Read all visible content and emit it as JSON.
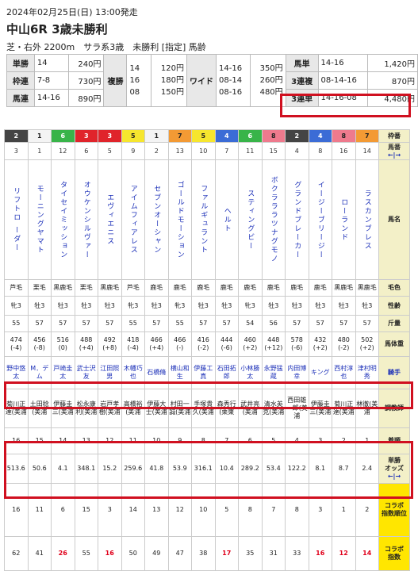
{
  "header": {
    "date": "2024年02月25日(日) 13:00発走",
    "title": "中山6R 3歳未勝利",
    "conditions": "芝・右外 2200m　サラ系3歳　未勝利 [指定] 馬齢"
  },
  "payout": {
    "tansho": {
      "label": "単勝",
      "combo": "14",
      "amount": "240円"
    },
    "wakuren": {
      "label": "枠連",
      "combo": "7-8",
      "amount": "730円"
    },
    "umaren": {
      "label": "馬連",
      "combo": "14-16",
      "amount": "890円"
    },
    "fukusho": {
      "label": "複勝",
      "combos": [
        "14",
        "16",
        "08"
      ],
      "amounts": [
        "120円",
        "180円",
        "150円"
      ]
    },
    "wide": {
      "label": "ワイド",
      "combos": [
        "14-16",
        "08-14",
        "08-16"
      ],
      "amounts": [
        "350円",
        "260円",
        "480円"
      ]
    },
    "umatan": {
      "label": "馬単",
      "combo": "14-16",
      "amount": "1,420円"
    },
    "sanrenpuku": {
      "label": "3連複",
      "combo": "08-14-16",
      "amount": "870円"
    },
    "sanrentan": {
      "label": "3連単",
      "combo": "14-16-08",
      "amount": "4,480円"
    }
  },
  "row_labels": {
    "waku": "枠番",
    "umaban": "馬番",
    "arrows": "←|→",
    "name": "馬名",
    "coat": "毛色",
    "sex_age": "性齢",
    "weight": "斤量",
    "body": "馬体重",
    "jockey": "騎手",
    "trainer": "調教師",
    "finish": "着順",
    "odds_a": "単勝",
    "odds_b": "オッズ",
    "rank_a": "コラボ",
    "rank_b": "指数順位",
    "score_a": "コラボ",
    "score_b": "指数"
  },
  "horses": [
    {
      "waku": "2",
      "waku_bg": "#444444",
      "waku_fg": "#ffffff",
      "uma": "3",
      "name": "リフトロ ーダー",
      "coat": "芦毛",
      "sex": "牝3",
      "kin": "55",
      "bw": "474",
      "bwd": "(-4)",
      "jockey": "野中悠太",
      "trainer": "菊川正達(美浦",
      "finish": "16",
      "odds": "513.6",
      "rank": "16",
      "score": "62",
      "score_red": false
    },
    {
      "waku": "1",
      "waku_bg": "#f4f4f4",
      "waku_fg": "#222222",
      "uma": "1",
      "name": "モーニングヤマト",
      "coat": "栗毛",
      "sex": "牡3",
      "kin": "57",
      "bw": "456",
      "bwd": "(-8)",
      "jockey": "M．デム",
      "trainer": "土田稔(美浦",
      "finish": "15",
      "odds": "50.6",
      "rank": "11",
      "score": "41",
      "score_red": false
    },
    {
      "waku": "6",
      "waku_bg": "#38b449",
      "waku_fg": "#ffffff",
      "uma": "12",
      "name": "タイセイミッション",
      "coat": "黒鹿毛",
      "sex": "牡3",
      "kin": "57",
      "bw": "516",
      "bwd": "(0)",
      "jockey": "戸崎圭太",
      "trainer": "伊藤圭三(美浦",
      "finish": "14",
      "odds": "4.1",
      "rank": "6",
      "score": "26",
      "score_red": true
    },
    {
      "waku": "3",
      "waku_bg": "#e0242b",
      "waku_fg": "#ffffff",
      "uma": "6",
      "name": "オウケンシルヴァー",
      "coat": "栗毛",
      "sex": "牡3",
      "kin": "57",
      "bw": "488",
      "bwd": "(+4)",
      "jockey": "武士沢友",
      "trainer": "松永康利(美浦",
      "finish": "13",
      "odds": "348.1",
      "rank": "15",
      "score": "55",
      "score_red": false
    },
    {
      "waku": "3",
      "waku_bg": "#e0242b",
      "waku_fg": "#ffffff",
      "uma": "5",
      "name": "エヴィエニス",
      "coat": "黒鹿毛",
      "sex": "牡3",
      "kin": "57",
      "bw": "492",
      "bwd": "(+8)",
      "jockey": "江田照男",
      "trainer": "岩戸孝樹(美浦",
      "finish": "12",
      "odds": "15.2",
      "rank": "3",
      "score": "16",
      "score_red": true
    },
    {
      "waku": "5",
      "waku_bg": "#f6e62e",
      "waku_fg": "#222222",
      "uma": "9",
      "name": "アイムフィアレス",
      "coat": "芦毛",
      "sex": "牝3",
      "kin": "55",
      "bw": "418",
      "bwd": "(-4)",
      "jockey": "木幡巧也",
      "trainer": "高橋裕(美浦",
      "finish": "11",
      "odds": "259.6",
      "rank": "14",
      "score": "50",
      "score_red": false
    },
    {
      "waku": "1",
      "waku_bg": "#f4f4f4",
      "waku_fg": "#222222",
      "uma": "2",
      "name": "セブンオーシャン",
      "coat": "鹿毛",
      "sex": "牡3",
      "kin": "57",
      "bw": "466",
      "bwd": "(+4)",
      "jockey": "石橋脩",
      "trainer": "伊藤大士(美浦",
      "finish": "10",
      "odds": "41.8",
      "rank": "13",
      "score": "49",
      "score_red": false
    },
    {
      "waku": "7",
      "waku_bg": "#f39a34",
      "waku_fg": "#222222",
      "uma": "13",
      "name": "ゴールドモーション",
      "coat": "鹿毛",
      "sex": "牝3",
      "kin": "55",
      "bw": "466",
      "bwd": "(-)",
      "jockey": "横山和生",
      "trainer": "村田一誠(美浦",
      "finish": "9",
      "odds": "53.9",
      "rank": "12",
      "score": "47",
      "score_red": false
    },
    {
      "waku": "5",
      "waku_bg": "#f6e62e",
      "waku_fg": "#222222",
      "uma": "10",
      "name": "ファルギュラント",
      "coat": "鹿毛",
      "sex": "牡3",
      "kin": "57",
      "bw": "416",
      "bwd": "(-2)",
      "jockey": "伊藤工真",
      "trainer": "手塚貴久(美浦",
      "finish": "8",
      "odds": "316.1",
      "rank": "10",
      "score": "38",
      "score_red": false
    },
    {
      "waku": "4",
      "waku_bg": "#3b6cd6",
      "waku_fg": "#ffffff",
      "uma": "7",
      "name": "ヘルト",
      "coat": "鹿毛",
      "sex": "牡3",
      "kin": "57",
      "bw": "444",
      "bwd": "(-6)",
      "jockey": "石田拓郎",
      "trainer": "森秀行(栗東",
      "finish": "7",
      "odds": "10.4",
      "rank": "5",
      "score": "17",
      "score_red": true
    },
    {
      "waku": "6",
      "waku_bg": "#38b449",
      "waku_fg": "#ffffff",
      "uma": "11",
      "name": "スティングビー",
      "coat": "鹿毛",
      "sex": "牝3",
      "kin": "54",
      "bw": "460",
      "bwd": "(+2)",
      "jockey": "小林勝太",
      "trainer": "武井亮(美浦",
      "finish": "6",
      "odds": "289.2",
      "rank": "8",
      "score": "35",
      "score_red": false
    },
    {
      "waku": "8",
      "waku_bg": "#ee7a8d",
      "waku_fg": "#222222",
      "uma": "15",
      "name": "ボクラララツナグモノ",
      "coat": "鹿毛",
      "sex": "牡3",
      "kin": "56",
      "bw": "448",
      "bwd": "(+12)",
      "jockey": "永野猛蔵",
      "trainer": "清水英克(美浦",
      "finish": "5",
      "odds": "53.4",
      "rank": "7",
      "score": "31",
      "score_red": false
    },
    {
      "waku": "2",
      "waku_bg": "#444444",
      "waku_fg": "#ffffff",
      "uma": "4",
      "name": "グランドブレーカー",
      "coat": "鹿毛",
      "sex": "牡3",
      "kin": "57",
      "bw": "578",
      "bwd": "(-6)",
      "jockey": "内田博幸",
      "trainer": "西田雄一郎(美浦",
      "finish": "4",
      "odds": "122.2",
      "rank": "8",
      "score": "33",
      "score_red": false
    },
    {
      "waku": "4",
      "waku_bg": "#3b6cd6",
      "waku_fg": "#ffffff",
      "uma": "8",
      "name": "イージーブリージー",
      "coat": "鹿毛",
      "sex": "牡3",
      "kin": "57",
      "bw": "432",
      "bwd": "(+2)",
      "jockey": "キング",
      "trainer": "伊藤圭三(美浦",
      "finish": "3",
      "odds": "8.1",
      "rank": "3",
      "score": "16",
      "score_red": true
    },
    {
      "waku": "8",
      "waku_bg": "#ee7a8d",
      "waku_fg": "#222222",
      "uma": "16",
      "name": "ローランド",
      "coat": "黒鹿毛",
      "sex": "牡3",
      "kin": "57",
      "bw": "480",
      "bwd": "(-2)",
      "jockey": "西村淳也",
      "trainer": "菊川正達(美浦",
      "finish": "2",
      "odds": "8.7",
      "rank": "1",
      "score": "12",
      "score_red": true
    },
    {
      "waku": "7",
      "waku_bg": "#f39a34",
      "waku_fg": "#222222",
      "uma": "14",
      "name": "ラスカンブレス",
      "coat": "黒鹿毛",
      "sex": "牡3",
      "kin": "57",
      "bw": "502",
      "bwd": "(+2)",
      "jockey": "津村明秀",
      "trainer": "林徹(美浦",
      "finish": "1",
      "odds": "2.4",
      "rank": "2",
      "score": "14",
      "score_red": true
    }
  ]
}
